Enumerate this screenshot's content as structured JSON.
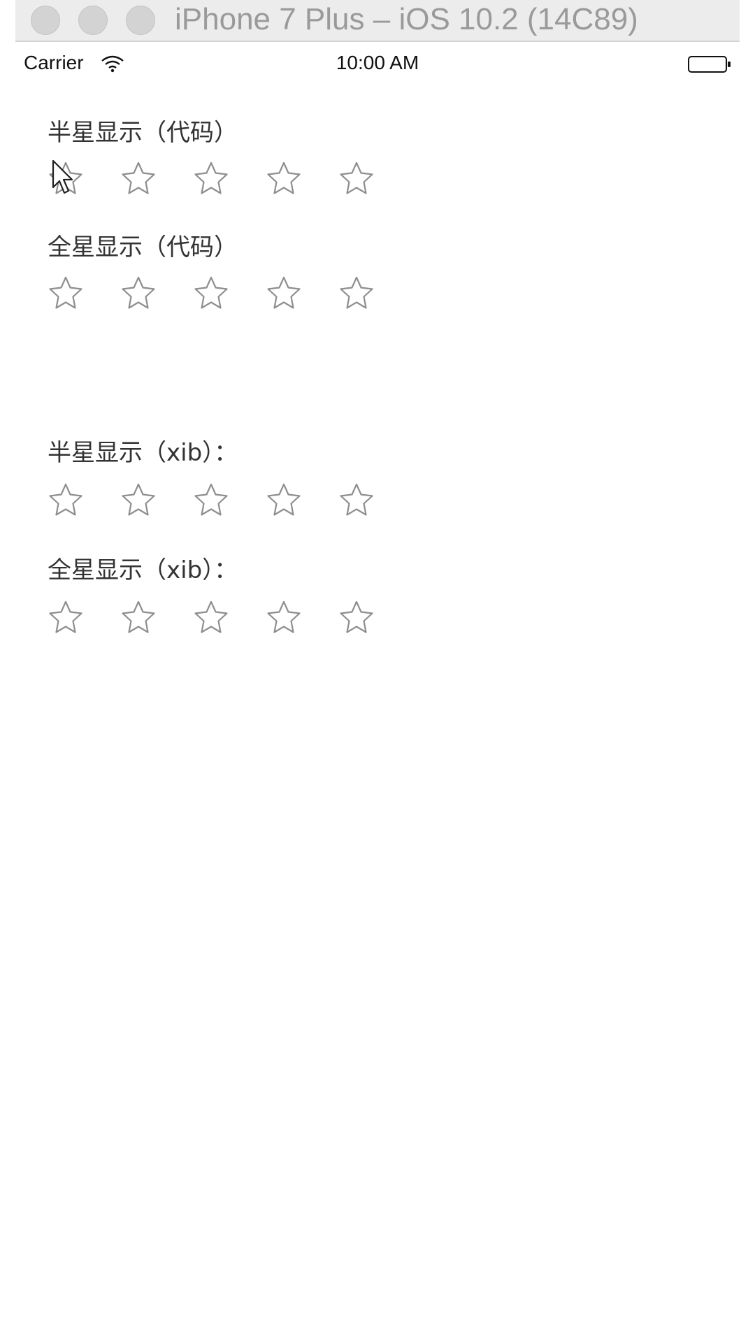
{
  "simulator": {
    "title": "iPhone 7 Plus – iOS 10.2 (14C89)"
  },
  "status_bar": {
    "carrier": "Carrier",
    "time": "10:00 AM",
    "wifi_icon": "wifi-icon",
    "battery_icon": "battery-icon"
  },
  "sections": [
    {
      "label": "半星显示（代码）",
      "max_stars": 5,
      "rating": 0
    },
    {
      "label": "全星显示（代码）",
      "max_stars": 5,
      "rating": 0
    },
    {
      "label": "半星显示（xib）：",
      "max_stars": 5,
      "rating": 0
    },
    {
      "label": "全星显示（xib）：",
      "max_stars": 5,
      "rating": 0
    }
  ],
  "colors": {
    "star_outline": "#8e8e8e",
    "label_text": "#333333"
  },
  "icons": {
    "star": "star-outline-icon",
    "cursor": "mouse-pointer-icon"
  }
}
